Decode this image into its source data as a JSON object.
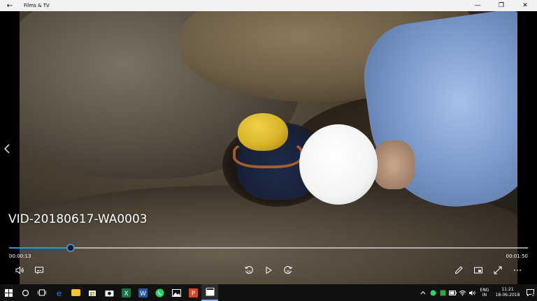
{
  "window": {
    "title": "Films & TV",
    "back_icon": "back-arrow-icon",
    "minimize_glyph": "—",
    "maximize_glyph": "❐",
    "close_glyph": "✕"
  },
  "video": {
    "title": "VID-20180617-WA0003",
    "current_time": "00:00:13",
    "duration": "00:01:50",
    "progress": 0.118
  },
  "controls": {
    "left": [
      "volume-icon",
      "subtitles-icon"
    ],
    "center": [
      "skip-back-10-icon",
      "play-icon",
      "skip-forward-30-icon"
    ],
    "right": [
      "edit-pencil-icon",
      "mini-view-icon",
      "fullscreen-icon",
      "more-icon"
    ],
    "skip_back_label": "10",
    "skip_forward_label": "30"
  },
  "taskbar": {
    "apps": [
      "start-icon",
      "cortana-icon",
      "task-view-icon",
      "edge-icon",
      "file-explorer-icon",
      "store-icon",
      "camera-icon",
      "excel-icon",
      "word-icon",
      "whatsapp-icon",
      "photos-icon",
      "powerpoint-icon",
      "films-tv-icon"
    ],
    "lang_line1": "ENG",
    "lang_line2": "IN",
    "time": "11:21",
    "date": "18-06-2018",
    "notification_count": "2"
  },
  "colors": {
    "accent": "#3a8fd6",
    "titlebar": "#f2f2f2",
    "taskbar": "#111111"
  }
}
